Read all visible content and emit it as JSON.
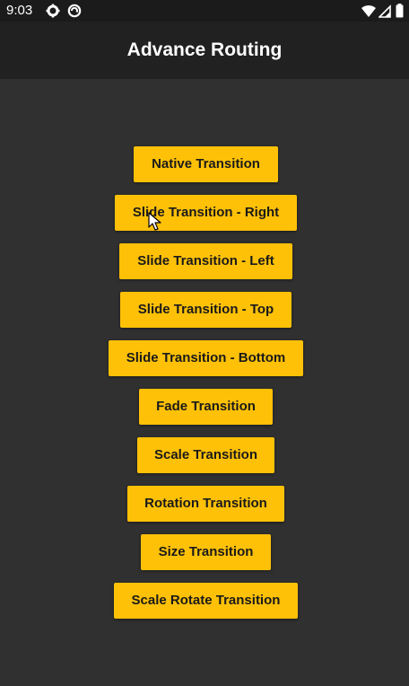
{
  "status_bar": {
    "time": "9:03",
    "icons": [
      "gear-icon",
      "at-sign-icon",
      "wifi-icon",
      "cellular-signal-icon",
      "battery-icon"
    ]
  },
  "app_bar": {
    "title": "Advance Routing"
  },
  "buttons": [
    {
      "label": "Native Transition"
    },
    {
      "label": "Slide Transition - Right"
    },
    {
      "label": "Slide Transition - Left"
    },
    {
      "label": "Slide Transition - Top"
    },
    {
      "label": "Slide Transition - Bottom"
    },
    {
      "label": "Fade Transition"
    },
    {
      "label": "Scale Transition"
    },
    {
      "label": "Rotation Transition"
    },
    {
      "label": "Size Transition"
    },
    {
      "label": "Scale Rotate Transition"
    }
  ],
  "colors": {
    "background": "#303030",
    "app_bar": "#212121",
    "status_bar": "#1b1b1b",
    "button": "#ffc107",
    "button_text": "#1a1a1a",
    "title_text": "#ffffff"
  }
}
